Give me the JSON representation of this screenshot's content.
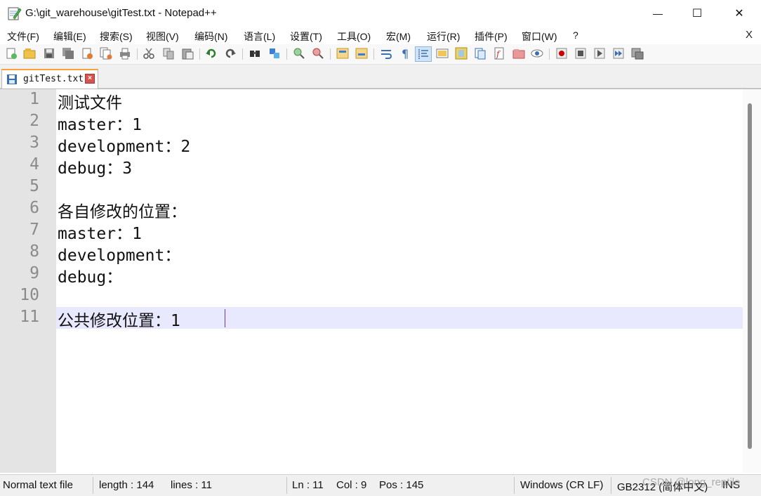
{
  "window": {
    "title": "G:\\git_warehouse\\gitTest.txt - Notepad++",
    "minimize": "—",
    "maximize": "☐",
    "close": "✕"
  },
  "menu": {
    "items": [
      "文件(F)",
      "编辑(E)",
      "搜索(S)",
      "视图(V)",
      "编码(N)",
      "语言(L)",
      "设置(T)",
      "工具(O)",
      "宏(M)",
      "运行(R)",
      "插件(P)",
      "窗口(W)",
      "?"
    ],
    "close": "X"
  },
  "tab": {
    "label": "gitTest.txt",
    "close": "×"
  },
  "editor": {
    "lines": [
      {
        "num": "1",
        "text": "测试文件"
      },
      {
        "num": "2",
        "text": "master：1"
      },
      {
        "num": "3",
        "text": "development：2"
      },
      {
        "num": "4",
        "text": "debug：3"
      },
      {
        "num": "5",
        "text": ""
      },
      {
        "num": "6",
        "text": "各自修改的位置："
      },
      {
        "num": "7",
        "text": "master：1"
      },
      {
        "num": "8",
        "text": "development："
      },
      {
        "num": "9",
        "text": "debug："
      },
      {
        "num": "10",
        "text": ""
      },
      {
        "num": "11",
        "text": "公共修改位置：1"
      }
    ],
    "current_line": 11
  },
  "status": {
    "file_type": "Normal text file",
    "length": "length : 144",
    "lines": "lines : 11",
    "ln": "Ln : 11",
    "col": "Col : 9",
    "pos": "Pos : 145",
    "eol": "Windows (CR LF)",
    "encoding": "GB2312 (简体中文)",
    "mode": "INS",
    "watermark": "CSDN @long_reptile"
  },
  "colors": {
    "accent_tab": "#f9a33a",
    "current_line": "#e8e8ff",
    "gutter": "#e4e4e4"
  }
}
